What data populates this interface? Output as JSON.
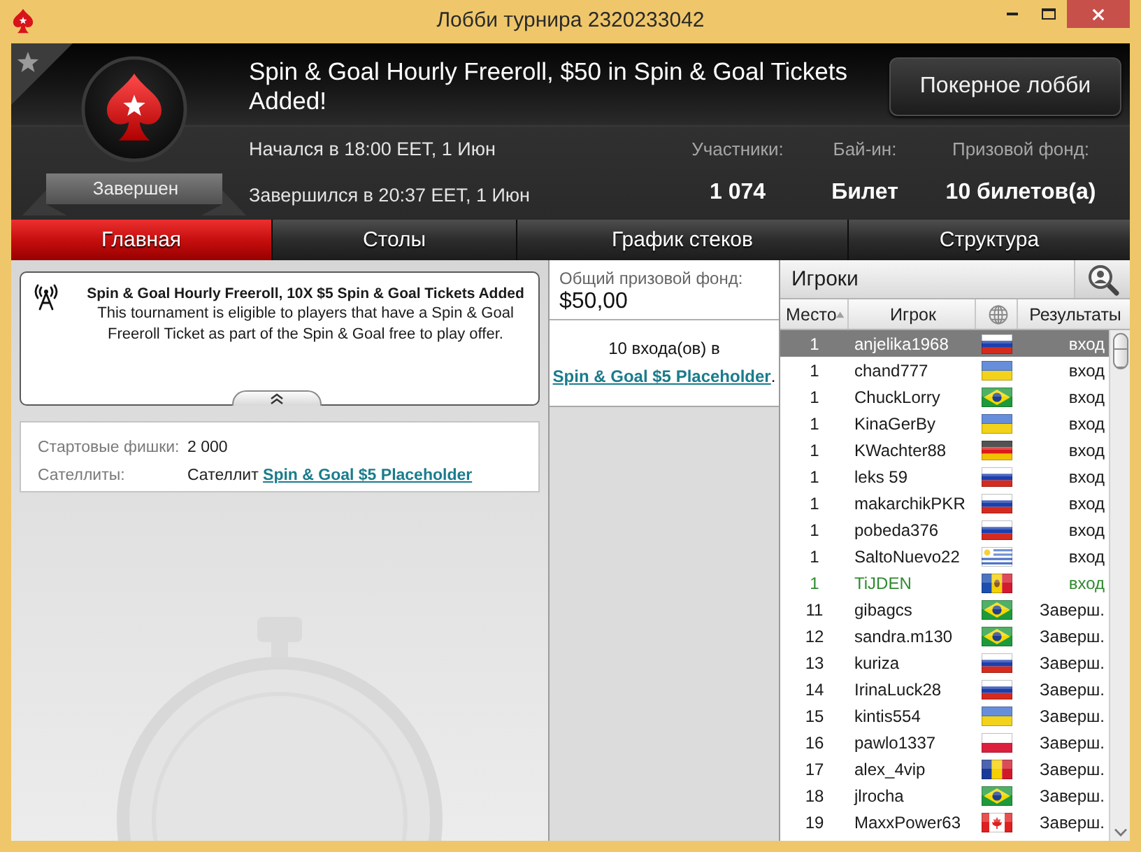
{
  "window": {
    "title": "Лобби турнира 2320233042"
  },
  "header": {
    "favorite": false,
    "status": "Завершен",
    "title": "Spin & Goal Hourly Freeroll, $50 in Spin & Goal Tickets Added!",
    "lobby_button": "Покерное лобби",
    "started": "Начался в 18:00 EET, 1 Июн",
    "finished": "Завершился в 20:37 EET, 1 Июн",
    "stats": [
      {
        "label": "Участники:",
        "value": "1 074"
      },
      {
        "label": "Бай-ин:",
        "value": "Билет"
      },
      {
        "label": "Призовой фонд:",
        "value": "10 билетов(а)"
      }
    ]
  },
  "tabs": [
    {
      "label": "Главная",
      "selected": true
    },
    {
      "label": "Столы",
      "selected": false
    },
    {
      "label": "График стеков",
      "selected": false
    },
    {
      "label": "Структура",
      "selected": false
    }
  ],
  "notice": {
    "title": "Spin & Goal Hourly Freeroll, 10X $5 Spin & Goal Tickets Added",
    "body": "This tournament is eligible to players that have a Spin & Goal Freeroll Ticket as part of the Spin & Goal free to play offer."
  },
  "info": [
    {
      "label": "Стартовые фишки:",
      "value": "2 000"
    },
    {
      "label": "Сателлиты:",
      "value": "Сателлит",
      "link": "Spin & Goal $5 Placeholder"
    }
  ],
  "prize": {
    "label": "Общий призовой фонд:",
    "amount": "$50,00",
    "text": "10 входа(ов) в",
    "link": "Spin & Goal $5 Placeholder",
    "suffix": "."
  },
  "players": {
    "title": "Игроки",
    "columns": [
      {
        "kind": "text",
        "label": "Место",
        "sorted": true
      },
      {
        "kind": "text",
        "label": "Игрок",
        "sorted": false
      },
      {
        "kind": "globe",
        "sorted": false
      },
      {
        "kind": "text",
        "label": "Результаты",
        "sorted": false
      }
    ],
    "rows": [
      {
        "place": "1",
        "name": "anjelika1968",
        "flag": {
          "kind": "russia"
        },
        "result": "вход",
        "selected": true,
        "highlighted": false
      },
      {
        "place": "1",
        "name": "chand777",
        "flag": {
          "kind": "ukraine"
        },
        "result": "вход",
        "selected": false,
        "highlighted": false
      },
      {
        "place": "1",
        "name": "ChuckLorry",
        "flag": {
          "kind": "brazil"
        },
        "result": "вход",
        "selected": false,
        "highlighted": false
      },
      {
        "place": "1",
        "name": "KinaGerBy",
        "flag": {
          "kind": "ukraine"
        },
        "result": "вход",
        "selected": false,
        "highlighted": false
      },
      {
        "place": "1",
        "name": "KWachter88",
        "flag": {
          "kind": "germany"
        },
        "result": "вход",
        "selected": false,
        "highlighted": false
      },
      {
        "place": "1",
        "name": "leks 59",
        "flag": {
          "kind": "russia"
        },
        "result": "вход",
        "selected": false,
        "highlighted": false
      },
      {
        "place": "1",
        "name": "makarchikPKR",
        "flag": {
          "kind": "russia"
        },
        "result": "вход",
        "selected": false,
        "highlighted": false
      },
      {
        "place": "1",
        "name": "pobeda376",
        "flag": {
          "kind": "russia"
        },
        "result": "вход",
        "selected": false,
        "highlighted": false
      },
      {
        "place": "1",
        "name": "SaltoNuevo22",
        "flag": {
          "kind": "uruguay"
        },
        "result": "вход",
        "selected": false,
        "highlighted": false
      },
      {
        "place": "1",
        "name": "TiJDEN",
        "flag": {
          "kind": "moldova"
        },
        "result": "вход",
        "selected": false,
        "highlighted": true
      },
      {
        "place": "11",
        "name": "gibagcs",
        "flag": {
          "kind": "brazil"
        },
        "result": "Заверш.",
        "selected": false,
        "highlighted": false
      },
      {
        "place": "12",
        "name": "sandra.m130",
        "flag": {
          "kind": "brazil"
        },
        "result": "Заверш.",
        "selected": false,
        "highlighted": false
      },
      {
        "place": "13",
        "name": "kuriza",
        "flag": {
          "kind": "russia"
        },
        "result": "Заверш.",
        "selected": false,
        "highlighted": false
      },
      {
        "place": "14",
        "name": "IrinaLuck28",
        "flag": {
          "kind": "russia"
        },
        "result": "Заверш.",
        "selected": false,
        "highlighted": false
      },
      {
        "place": "15",
        "name": "kintis554",
        "flag": {
          "kind": "ukraine"
        },
        "result": "Заверш.",
        "selected": false,
        "highlighted": false
      },
      {
        "place": "16",
        "name": "pawlo1337",
        "flag": {
          "kind": "poland"
        },
        "result": "Заверш.",
        "selected": false,
        "highlighted": false
      },
      {
        "place": "17",
        "name": "alex_4vip",
        "flag": {
          "kind": "romania"
        },
        "result": "Заверш.",
        "selected": false,
        "highlighted": false
      },
      {
        "place": "18",
        "name": "jlrocha",
        "flag": {
          "kind": "brazil"
        },
        "result": "Заверш.",
        "selected": false,
        "highlighted": false
      },
      {
        "place": "19",
        "name": "MaxxPower63",
        "flag": {
          "kind": "canada"
        },
        "result": "Заверш.",
        "selected": false,
        "highlighted": false
      }
    ]
  }
}
